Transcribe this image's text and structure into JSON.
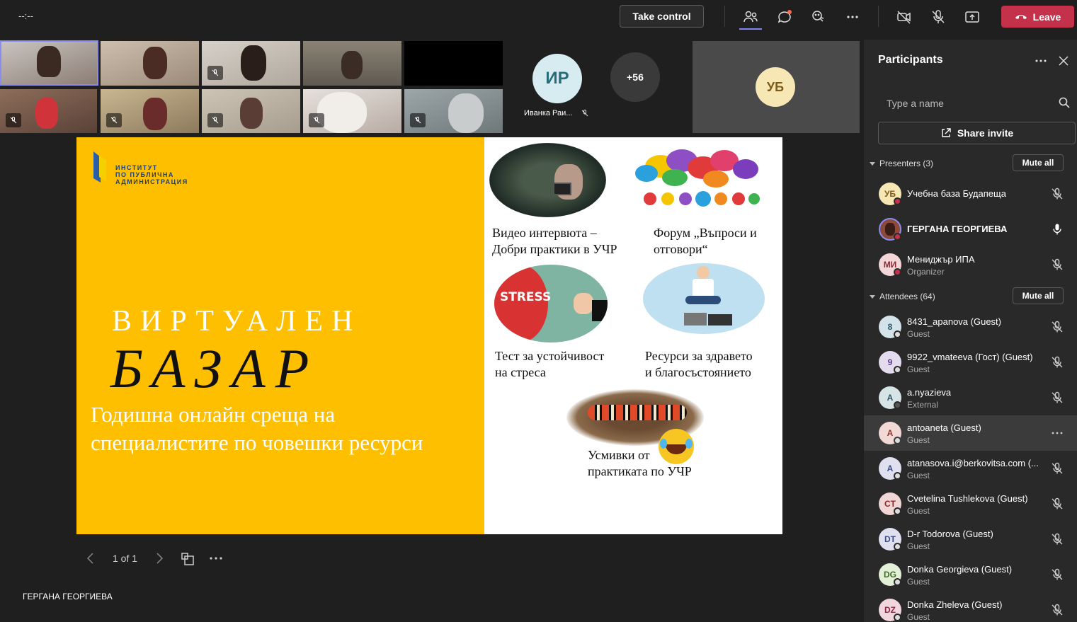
{
  "topbar": {
    "timer": "--:--",
    "take_control": "Take control",
    "leave": "Leave"
  },
  "video_tiles": {
    "avatar_ir": {
      "initials": "ИР",
      "name": "Иванка Раи..."
    },
    "overflow": "+56",
    "avatar_ub": "УБ"
  },
  "slide": {
    "logo_lines": [
      "ИНСТИТУТ",
      "ПО ПУБЛИЧНА",
      "АДМИНИСТРАЦИЯ"
    ],
    "title_line1": "ВИРТУАЛЕН",
    "title_line2": "БАЗАР",
    "subtitle_line1": "Годишна онлайн среща на",
    "subtitle_line2": "специалистите по човешки ресурси",
    "item1_line1": "Видео интервюта –",
    "item1_line2": "Добри практики в УЧР",
    "item2_line1": "Форум „Въпроси и",
    "item2_line2": "отговори“",
    "stress_label": "STRESS",
    "item3_line1": "Тест за устойчивост",
    "item3_line2": "на стреса",
    "item4_line1": "Ресурси за здравето",
    "item4_line2": "и благосъстоянието",
    "item5_line1": "Усмивки от",
    "item5_line2": "практиката по УЧР"
  },
  "slide_controls": {
    "page": "1 of 1"
  },
  "presenter_name": "ГЕРГАНА ГЕОРГИЕВА",
  "panel": {
    "title": "Participants",
    "search_placeholder": "Type a name",
    "share_invite": "Share invite",
    "presenters_header": "Presenters (3)",
    "attendees_header": "Attendees (64)",
    "mute_all": "Mute all",
    "presenters": [
      {
        "initials": "УБ",
        "name": "Учебна база Будапеща",
        "sub": ""
      },
      {
        "initials": "",
        "name": "ГЕРГАНА ГЕОРГИЕВА",
        "sub": ""
      },
      {
        "initials": "МИ",
        "name": "Мениджър ИПА",
        "sub": "Organizer"
      }
    ],
    "attendees": [
      {
        "initials": "8",
        "name": "8431_apanova (Guest)",
        "sub": "Guest"
      },
      {
        "initials": "9",
        "name": "9922_vmateeva (Гост) (Guest)",
        "sub": "Guest"
      },
      {
        "initials": "A",
        "name": "a.nyazieva",
        "sub": "External"
      },
      {
        "initials": "A",
        "name": "antoaneta (Guest)",
        "sub": "Guest"
      },
      {
        "initials": "A",
        "name": "atanasova.i@berkovitsa.com (...",
        "sub": "Guest"
      },
      {
        "initials": "CT",
        "name": "Cvetelina Tushlekova (Guest)",
        "sub": "Guest"
      },
      {
        "initials": "DT",
        "name": "D-r Todorova (Guest)",
        "sub": "Guest"
      },
      {
        "initials": "DG",
        "name": "Donka Georgieva (Guest)",
        "sub": "Guest"
      },
      {
        "initials": "DZ",
        "name": "Donka Zheleva (Guest)",
        "sub": "Guest"
      }
    ]
  },
  "colors": {
    "leave": "#c4314b",
    "slide_yellow": "#fdbf00",
    "accent": "#6264a7"
  }
}
